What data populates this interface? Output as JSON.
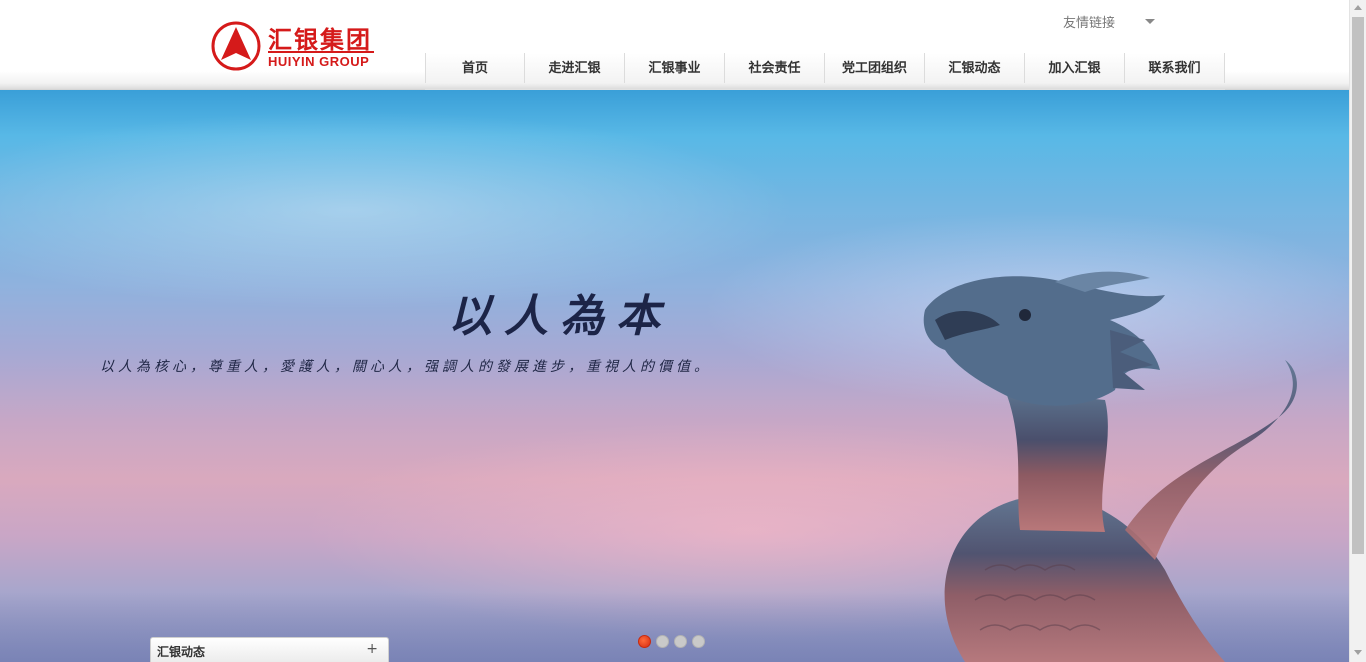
{
  "brand": {
    "name_cn": "汇银集团",
    "name_en": "HUIYIN GROUP",
    "color": "#d51a1a"
  },
  "header": {
    "friend_links": "友情链接",
    "nav": [
      {
        "label": "首页"
      },
      {
        "label": "走进汇银"
      },
      {
        "label": "汇银事业"
      },
      {
        "label": "社会责任"
      },
      {
        "label": "党工团组织"
      },
      {
        "label": "汇银动态"
      },
      {
        "label": "加入汇银"
      },
      {
        "label": "联系我们"
      }
    ]
  },
  "hero": {
    "slogan": "以人為本",
    "subline": "以人為核心，尊重人，愛護人，關心人，强調人的發展進步，重視人的價值。",
    "slide_count": 4,
    "active_slide": 1
  },
  "news_panel": {
    "title": "汇银动态",
    "expand_icon": "+"
  },
  "icons": {
    "logo": "triangle-arrow-logo-icon",
    "dropdown": "caret-down-icon",
    "expand": "plus-icon"
  }
}
